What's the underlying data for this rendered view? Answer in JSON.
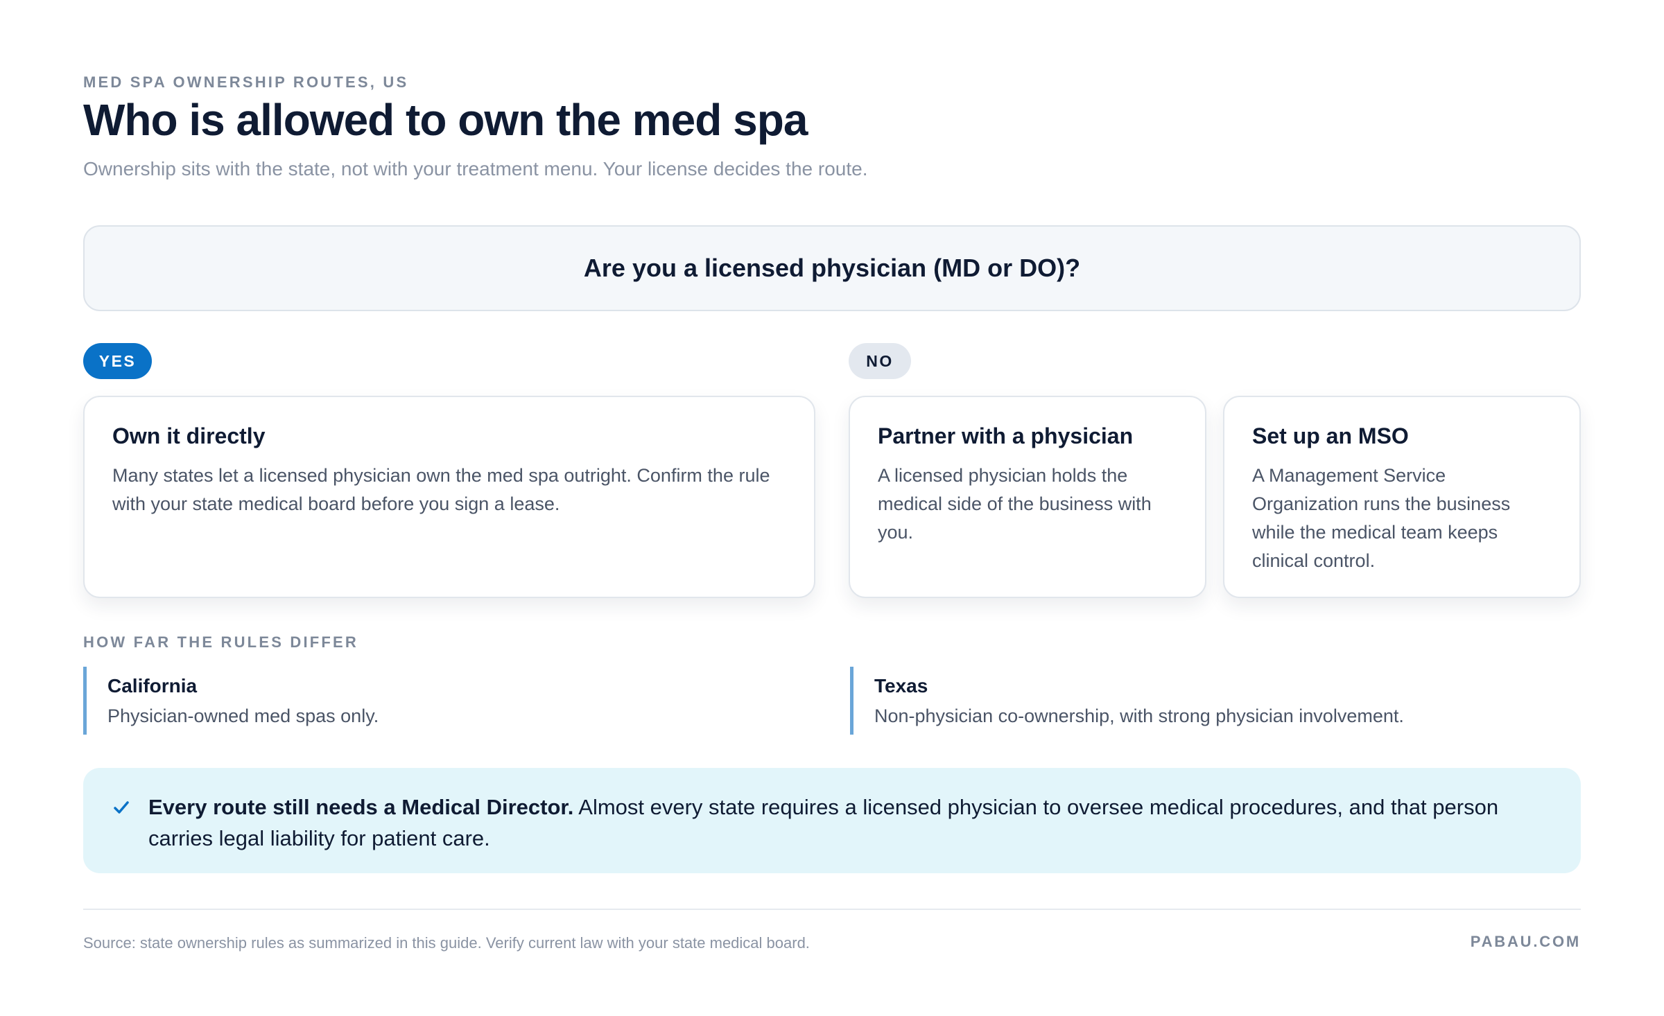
{
  "header": {
    "eyebrow": "MED SPA OWNERSHIP ROUTES, US",
    "title": "Who is allowed to own the med spa",
    "subtitle": "Ownership sits with the state, not with your treatment menu. Your license decides the route."
  },
  "question": "Are you a licensed physician (MD or DO)?",
  "branches": {
    "yes": {
      "label": "YES",
      "cards": [
        {
          "title": "Own it directly",
          "body": "Many states let a licensed physician own the med spa outright. Confirm the rule with your state medical board before you sign a lease."
        }
      ]
    },
    "no": {
      "label": "NO",
      "cards": [
        {
          "title": "Partner with a physician",
          "body": "A licensed physician holds the medical side of the business with you."
        },
        {
          "title": "Set up an MSO",
          "body": "A Management Service Organization runs the business while the medical team keeps clinical control."
        }
      ]
    }
  },
  "differences": {
    "heading": "HOW FAR THE RULES DIFFER",
    "states": [
      {
        "name": "California",
        "rule": "Physician-owned med spas only."
      },
      {
        "name": "Texas",
        "rule": "Non-physician co-ownership, with strong physician involvement."
      }
    ]
  },
  "callout": {
    "icon": "check-icon",
    "bold": "Every route still needs a Medical Director.",
    "text": " Almost every state requires a licensed physician to oversee medical procedures, and that person carries legal liability for patient care."
  },
  "footer": {
    "source": "Source: state ownership rules as summarized in this guide. Verify current law with your state medical board.",
    "brand": "PABAU.COM"
  },
  "colors": {
    "accent": "#0a72c7",
    "text": "#0f1b33",
    "muted": "#7d8899",
    "callout_bg": "#e2f5fa",
    "state_bar": "#6aa6d8"
  }
}
